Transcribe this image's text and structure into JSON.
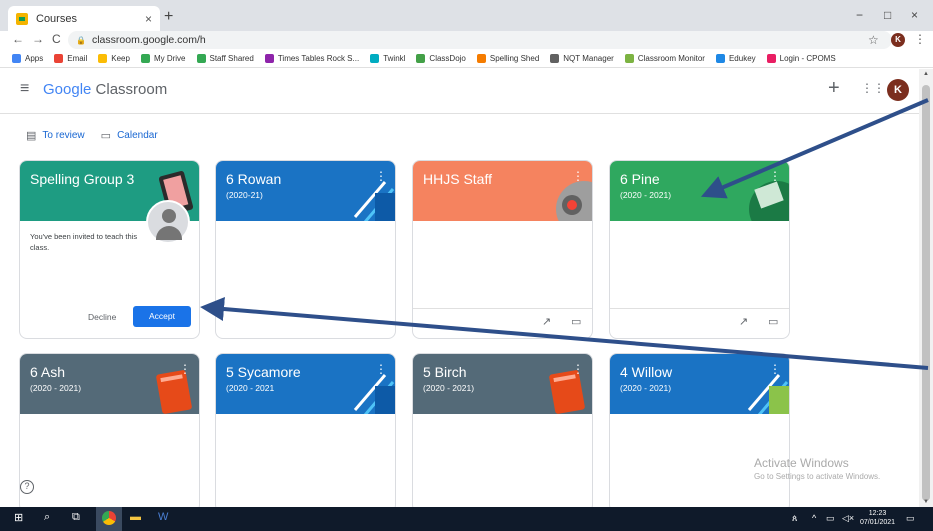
{
  "browser": {
    "tab_title": "Courses",
    "tab_close": "×",
    "new_tab": "+",
    "win_min": "−",
    "win_max": "□",
    "win_close": "×",
    "back": "←",
    "forward": "→",
    "reload": "C",
    "url": "classroom.google.com/h",
    "star": "☆",
    "profile_letter": "K",
    "menu": "⋮"
  },
  "bookmarks": [
    {
      "label": "Apps",
      "color": "#4285f4"
    },
    {
      "label": "Email",
      "color": "#ea4335"
    },
    {
      "label": "Keep",
      "color": "#fbbc05"
    },
    {
      "label": "My Drive",
      "color": "#34a853"
    },
    {
      "label": "Staff Shared",
      "color": "#34a853"
    },
    {
      "label": "Times Tables Rock S...",
      "color": "#8e24aa"
    },
    {
      "label": "Twinkl",
      "color": "#00acc1"
    },
    {
      "label": "ClassDojo",
      "color": "#43a047"
    },
    {
      "label": "Spelling Shed",
      "color": "#f57c00"
    },
    {
      "label": "NQT Manager",
      "color": "#616161"
    },
    {
      "label": "Classroom Monitor",
      "color": "#7cb342"
    },
    {
      "label": "Edukey",
      "color": "#1e88e5"
    },
    {
      "label": "Login - CPOMS",
      "color": "#e91e63"
    }
  ],
  "header": {
    "brand_google": "Google",
    "brand_classroom": "Classroom",
    "plus": "+",
    "apps": "⋮⋮⋮",
    "avatar": "K"
  },
  "links": {
    "to_review": "To review",
    "calendar": "Calendar"
  },
  "cards": [
    {
      "name": "Spelling Group 3",
      "section": "",
      "color": "#1e9c82",
      "invite": true,
      "invite_text": "You've been invited to teach this class.",
      "decline": "Decline",
      "accept": "Accept"
    },
    {
      "name": "6 Rowan",
      "section": "(2020-21)",
      "color": "#1a73c4"
    },
    {
      "name": "HHJS Staff",
      "section": "",
      "color": "#f5835f"
    },
    {
      "name": "6 Pine",
      "section": "(2020 - 2021)",
      "color": "#2fa85f"
    },
    {
      "name": "6 Ash",
      "section": "(2020 - 2021)",
      "color": "#546a78"
    },
    {
      "name": "5 Sycamore",
      "section": "(2020 - 2021",
      "color": "#1a73c4"
    },
    {
      "name": "5 Birch",
      "section": "(2020 - 2021)",
      "color": "#546a78"
    },
    {
      "name": "4 Willow",
      "section": "(2020 - 2021)",
      "color": "#1a73c4"
    }
  ],
  "overlay": {
    "activate_title": "Activate Windows",
    "activate_sub": "Go to Settings to activate Windows."
  },
  "taskbar": {
    "time": "12:23",
    "date": "07/01/2021"
  }
}
